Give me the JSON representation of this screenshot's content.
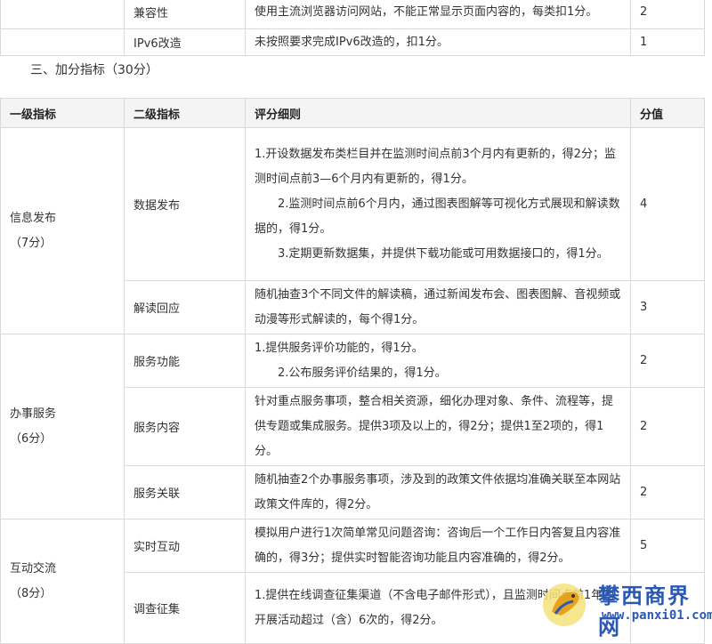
{
  "top_rows": [
    {
      "sub": "兼容性",
      "rule": "使用主流浏览器访问网站，不能正常显示页面内容的，每类扣1分。",
      "score": "2"
    },
    {
      "sub": "IPv6改造",
      "rule": "未按照要求完成IPv6改造的，扣1分。",
      "score": "1"
    }
  ],
  "section_title": "三、加分指标（30分）",
  "headers": [
    "一级指标",
    "二级指标",
    "评分细则",
    "分值"
  ],
  "groups": [
    {
      "name": "信息发布",
      "sub_name": "（7分）"
    },
    {
      "name": "办事服务",
      "sub_name": "（6分）"
    },
    {
      "name": "互动交流",
      "sub_name": "（8分）"
    }
  ],
  "rows": [
    {
      "sub": "数据发布",
      "score": "4",
      "lines": [
        "1.开设数据发布类栏目并在监测时间点前3个月内有更新的，得2分；监测时间点前3—6个月内有更新的，得1分。",
        "2.监测时间点前6个月内，通过图表图解等可视化方式展现和解读数据的，得1分。",
        "3.定期更新数据集，并提供下载功能或可用数据接口的，得1分。"
      ]
    },
    {
      "sub": "解读回应",
      "score": "3",
      "lines": [
        "随机抽查3个不同文件的解读稿，通过新闻发布会、图表图解、音视频或动漫等形式解读的，每个得1分。"
      ]
    },
    {
      "sub": "服务功能",
      "score": "2",
      "lines": [
        "1.提供服务评价功能的，得1分。",
        "2.公布服务评价结果的，得1分。"
      ]
    },
    {
      "sub": "服务内容",
      "score": "2",
      "lines": [
        "针对重点服务事项，整合相关资源，细化办理对象、条件、流程等，提供专题或集成服务。提供3项及以上的，得2分；提供1至2项的，得1分。"
      ]
    },
    {
      "sub": "服务关联",
      "score": "2",
      "lines": [
        "随机抽查2个办事服务事项，涉及到的政策文件依据均准确关联至本网站政策文件库的，得2分。"
      ]
    },
    {
      "sub": "实时互动",
      "score": "5",
      "lines": [
        "模拟用户进行1次简单常见问题咨询：咨询后一个工作日内答复且内容准确的，得3分；提供实时智能咨询功能且内容准确的，得2分。"
      ]
    },
    {
      "sub": "调查征集",
      "score": "",
      "lines": [
        "1.提供在线调查征集渠道（不含电子邮件形式），且监测时间点前1年内开展活动超过（含）6次的，得2分。"
      ]
    }
  ],
  "watermark": {
    "title": "攀西商界网",
    "url": "www.panxi01.com",
    "brand_color": "#2a58b5"
  }
}
